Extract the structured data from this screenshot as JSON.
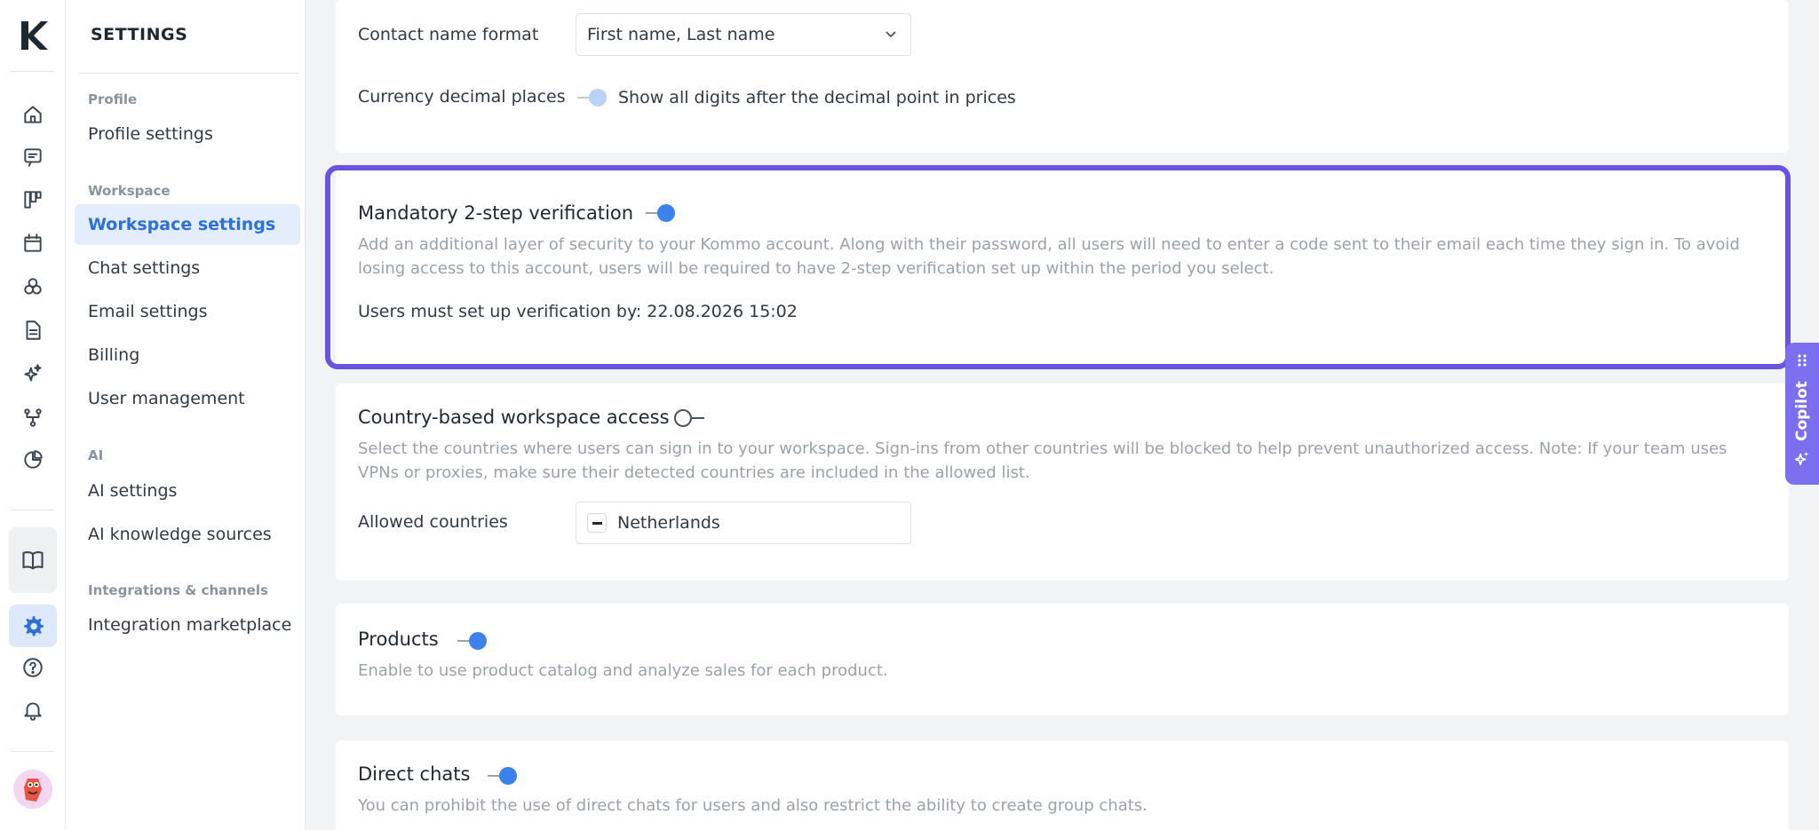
{
  "menu": {
    "title": "SETTINGS",
    "groups": [
      {
        "label": "Profile",
        "items": [
          "Profile settings"
        ]
      },
      {
        "label": "Workspace",
        "items": [
          "Workspace settings",
          "Chat settings",
          "Email settings",
          "Billing",
          "User management"
        ]
      },
      {
        "label": "AI",
        "items": [
          "AI settings",
          "AI knowledge sources"
        ]
      },
      {
        "label": "Integrations & channels",
        "items": [
          "Integration marketplace"
        ]
      }
    ],
    "active_item": "Workspace settings"
  },
  "general": {
    "contact_name_label": "Contact name format",
    "contact_name_value": "First name, Last name",
    "currency_label": "Currency decimal places",
    "currency_toggle_text": "Show all digits after the decimal point in prices"
  },
  "two_step": {
    "title": "Mandatory 2-step verification",
    "description": "Add an additional layer of security to your Kommo account. Along with their password, all users will need to enter a code sent to their email each time they sign in. To avoid losing access to this account, users will be required to have 2-step verification set up within the period you select.",
    "deadline": "Users must set up verification by: 22.08.2026 15:02",
    "enabled": true
  },
  "country_access": {
    "title": "Country-based workspace access",
    "description": "Select the countries where users can sign in to your workspace. Sign-ins from other countries will be blocked to help prevent unauthorized access. Note: If your team uses VPNs or proxies, make sure their detected countries are included in the allowed list.",
    "allowed_label": "Allowed countries",
    "allowed_value": "Netherlands",
    "enabled": false
  },
  "products": {
    "title": "Products",
    "description": "Enable to use product catalog and analyze sales for each product.",
    "enabled": true
  },
  "direct_chats": {
    "title": "Direct chats",
    "description": "You can prohibit the use of direct chats for users and also restrict the ability to create group chats.",
    "enabled": true
  },
  "copilot": {
    "label": "Copilot"
  },
  "colors": {
    "accent": "#2d6fdb",
    "highlight": "#6b52e0",
    "toggle_on": "#3b82ea",
    "copilot": "#7b6ff0"
  },
  "icons": {
    "rail": [
      "kommo-logo",
      "home-icon",
      "chat-icon",
      "pipeline-icon",
      "calendar-icon",
      "lists-icon",
      "document-icon",
      "ai-sparkle-icon",
      "automation-icon",
      "stats-icon",
      "book-icon",
      "gear-icon",
      "help-icon",
      "bell-icon",
      "avatar"
    ]
  }
}
